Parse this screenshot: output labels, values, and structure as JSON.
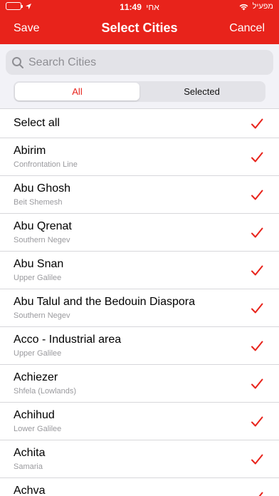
{
  "statusbar": {
    "carrier": "מפעיל",
    "time": "11:49",
    "network_label": "אחי"
  },
  "nav": {
    "left_label": "Save",
    "title": "Select Cities",
    "right_label": "Cancel"
  },
  "search": {
    "placeholder": "Search Cities",
    "value": ""
  },
  "segments": {
    "all_label": "All",
    "selected_label": "Selected",
    "active": "All"
  },
  "select_all": {
    "label": "Select all",
    "checked": true
  },
  "cities": [
    {
      "name": "Abirim",
      "region": "Confrontation Line",
      "checked": true
    },
    {
      "name": "Abu Ghosh",
      "region": "Beit Shemesh",
      "checked": true
    },
    {
      "name": "Abu Qrenat",
      "region": "Southern Negev",
      "checked": true
    },
    {
      "name": "Abu Snan",
      "region": "Upper Galilee",
      "checked": true
    },
    {
      "name": "Abu Talul and the Bedouin Diaspora",
      "region": "Southern Negev",
      "checked": true
    },
    {
      "name": "Acco - Industrial area",
      "region": "Upper Galilee",
      "checked": true
    },
    {
      "name": "Achiezer",
      "region": "Shfela (Lowlands)",
      "checked": true
    },
    {
      "name": "Achihud",
      "region": "Lower Galilee",
      "checked": true
    },
    {
      "name": "Achita",
      "region": "Samaria",
      "checked": true
    },
    {
      "name": "Achva",
      "region": "",
      "checked": true
    }
  ],
  "colors": {
    "accent": "#e8231b",
    "background": "#ffffff",
    "search_bg": "#e3e3e8",
    "secondary_text": "#9a9a9e"
  },
  "icons": {
    "search": "magnifier",
    "check": "checkmark",
    "wifi": "wifi",
    "battery": "battery-full",
    "location": "location-arrow"
  }
}
